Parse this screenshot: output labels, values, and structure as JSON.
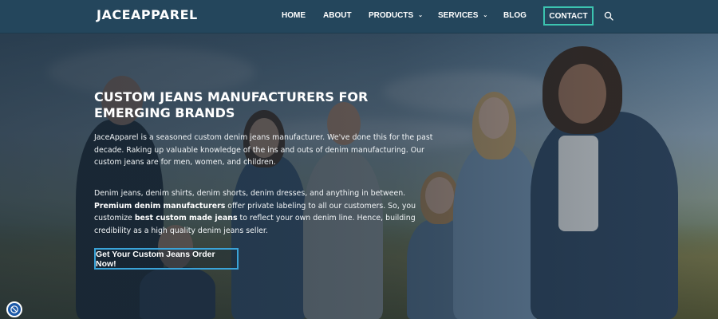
{
  "brand": {
    "logo_text": "JACEAPPAREL",
    "accent": "#3cc4b0",
    "cta_border": "#3aa3d8",
    "header_bg": "#24465c"
  },
  "nav": {
    "items": [
      {
        "label": "HOME",
        "has_dropdown": false
      },
      {
        "label": "ABOUT",
        "has_dropdown": false
      },
      {
        "label": "PRODUCTS",
        "has_dropdown": true
      },
      {
        "label": "SERVICES",
        "has_dropdown": true
      },
      {
        "label": "BLOG",
        "has_dropdown": false
      }
    ],
    "dropdown_icon": "chevron-down-icon",
    "contact_label": "CONTACT",
    "search_icon": "search-icon"
  },
  "hero": {
    "title": "CUSTOM JEANS MANUFACTURERS FOR EMERGING BRANDS",
    "paragraph1": "JaceApparel is a seasoned custom denim jeans manufacturer. We've done this for the past decade. Raking up valuable knowledge of the ins and outs of denim manufacturing. Our custom jeans are for men, women, and children.",
    "paragraph2": {
      "part1": "Denim jeans, denim shirts, denim shorts, denim dresses, and anything in between.",
      "bold1": "Premium denim manufacturers",
      "part2": "offer private labeling to all our customers. So, you customize",
      "bold2": "best custom made jeans",
      "part3": "to reflect your own denim line. Hence, building credibility as a high quality denim jeans seller."
    },
    "cta_label": "Get Your Custom Jeans Order Now!"
  },
  "accessibility_widget": {
    "icon": "accessibility-icon"
  }
}
